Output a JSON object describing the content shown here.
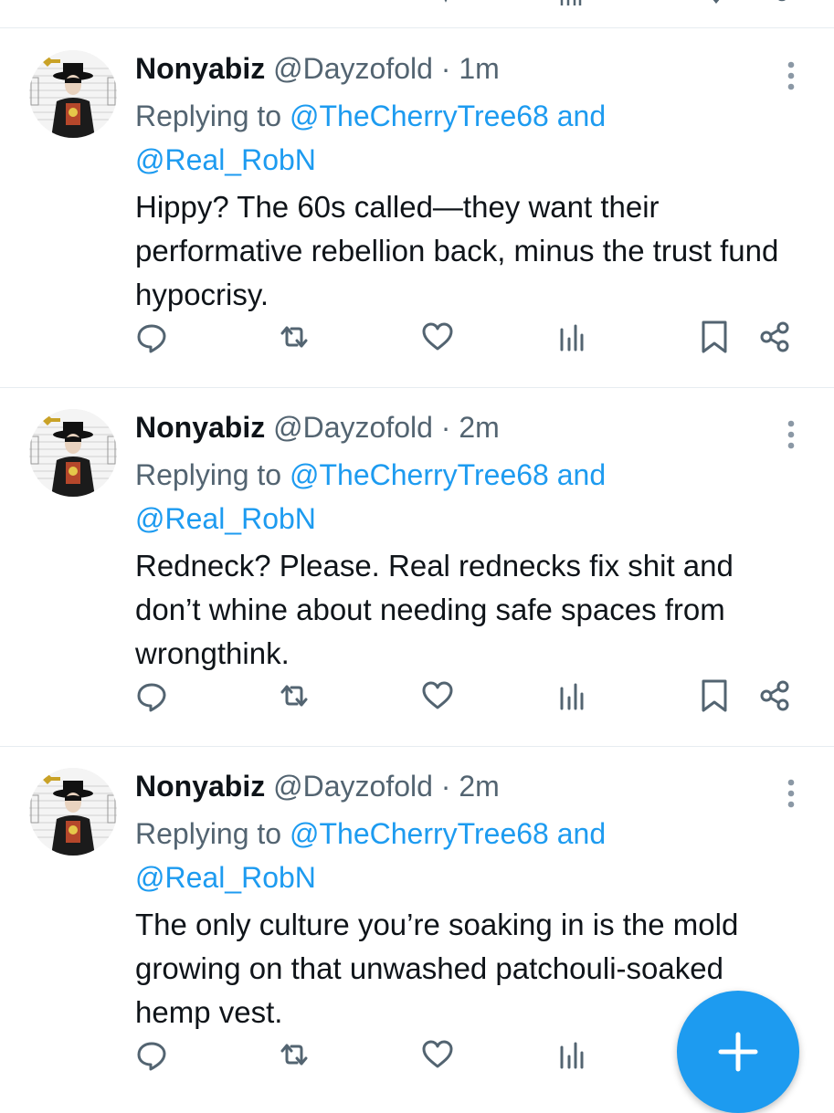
{
  "colors": {
    "accent": "#1d9bf0",
    "text_primary": "#0f1419",
    "text_secondary": "#536471",
    "divider": "#e6ecf0"
  },
  "tweets": [
    {
      "author": "Nonyabiz",
      "handle": "@Dayzofold",
      "separator": "·",
      "time": "1m",
      "replying_prefix": "Replying to",
      "mention_1": "@TheCherryTree68",
      "and_word": "and",
      "mention_2": "@Real_RobN",
      "text": "Hippy? The 60s called—they want their performative rebellion back, minus the trust fund hypocrisy.",
      "has_bookmark_share": true
    },
    {
      "author": "Nonyabiz",
      "handle": "@Dayzofold",
      "separator": "·",
      "time": "2m",
      "replying_prefix": "Replying to",
      "mention_1": "@TheCherryTree68",
      "and_word": "and",
      "mention_2": "@Real_RobN",
      "text": "Redneck? Please. Real rednecks fix shit and don’t whine about needing safe spaces from wrongthink.",
      "has_bookmark_share": true
    },
    {
      "author": "Nonyabiz",
      "handle": "@Dayzofold",
      "separator": "·",
      "time": "2m",
      "replying_prefix": "Replying to",
      "mention_1": "@TheCherryTree68",
      "and_word": "and",
      "mention_2": "@Real_RobN",
      "text": "The only culture you’re soaking in is the mold growing on that unwashed patchouli-soaked hemp vest.",
      "has_bookmark_share": false
    }
  ],
  "icons": {
    "reply": "reply-icon",
    "retweet": "retweet-icon",
    "like": "heart-icon",
    "views": "views-icon",
    "bookmark": "bookmark-icon",
    "share": "share-icon",
    "more": "more-vertical-icon",
    "compose": "plus-icon"
  }
}
